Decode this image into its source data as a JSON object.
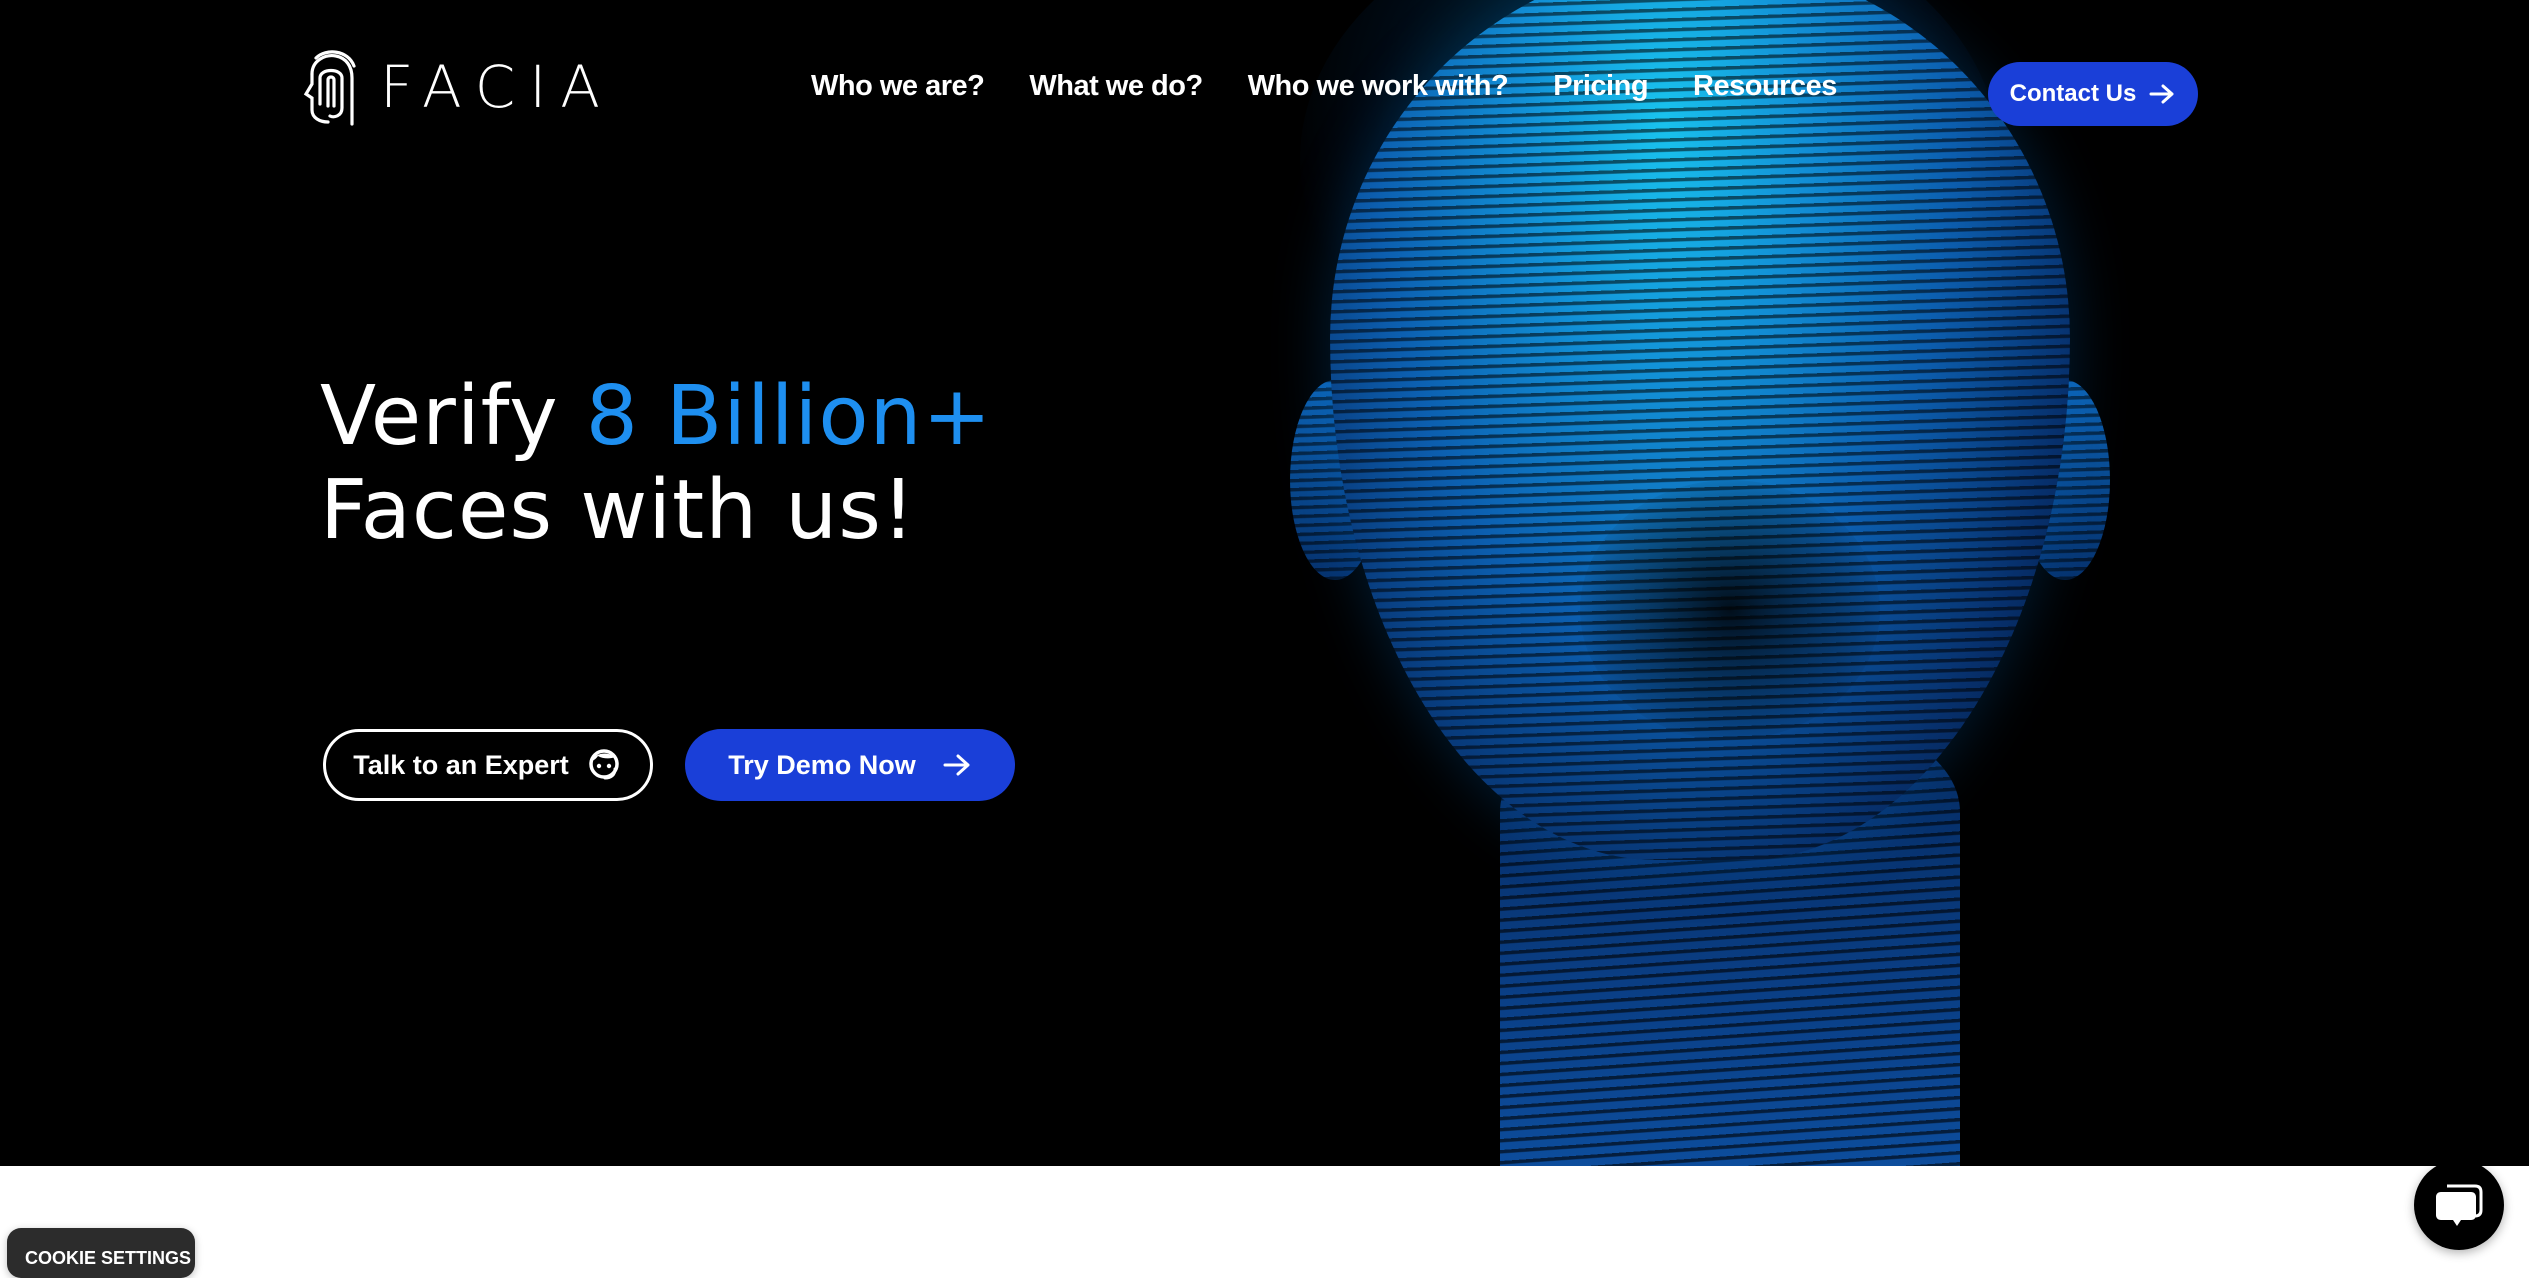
{
  "brand": {
    "name": "FACIA",
    "logo_icon": "face-fingerprint-icon"
  },
  "nav": {
    "items": [
      {
        "label": "Who we are?"
      },
      {
        "label": "What we do?"
      },
      {
        "label": "Who we work with?"
      },
      {
        "label": "Pricing"
      },
      {
        "label": "Resources"
      }
    ],
    "contact_label": "Contact Us",
    "contact_icon": "arrow-right-icon"
  },
  "hero": {
    "headline_prefix": "Verify ",
    "headline_accent": "8 Billion+",
    "headline_line2": "Faces with us!",
    "expert_button_label": "Talk to an Expert",
    "expert_button_icon": "support-agent-icon",
    "demo_button_label": "Try Demo Now",
    "demo_button_icon": "arrow-right-icon",
    "image_subject": "3D wireframe human face made of glowing blue lines"
  },
  "widgets": {
    "cookie_label": "COOKIE SETTINGS",
    "chat_icon": "chat-bubbles-icon"
  },
  "colors": {
    "background": "#000000",
    "accent_text": "#1e8ff0",
    "primary_button": "#1a3fd8",
    "text": "#ffffff"
  }
}
